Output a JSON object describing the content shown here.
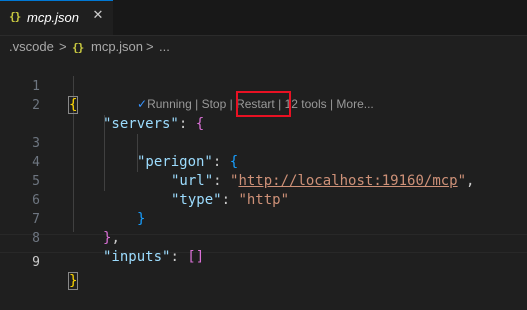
{
  "tab": {
    "icon": "{}",
    "label": "mcp.json",
    "close": "✕"
  },
  "breadcrumb": {
    "folder": ".vscode",
    "sep1": ">",
    "file_icon": "{}",
    "file": "mcp.json",
    "sep2": ">",
    "more": "..."
  },
  "line_numbers": [
    "1",
    "2",
    "3",
    "4",
    "5",
    "6",
    "7",
    "8",
    "9"
  ],
  "code": {
    "l1_open": "{",
    "l2_key": "\"servers\"",
    "l2_colon": ": ",
    "l2_brace": "{",
    "l3_key": "\"perigon\"",
    "l3_colon": ": ",
    "l3_brace": "{",
    "l4_key": "\"url\"",
    "l4_colon": ": ",
    "l4_q1": "\"",
    "l4_val": "http://localhost:19160/mcp",
    "l4_q2": "\"",
    "l4_comma": ",",
    "l5_key": "\"type\"",
    "l5_colon": ": ",
    "l5_val": "\"http\"",
    "l6_brace": "}",
    "l7_brace": "}",
    "l7_comma": ",",
    "l8_key": "\"inputs\"",
    "l8_colon": ": ",
    "l8_val": "[]",
    "l9_close": "}"
  },
  "codelens": {
    "running": "Running",
    "sep": "|",
    "stop": "Stop",
    "restart": "Restart",
    "tools": "12 tools",
    "more": "More..."
  },
  "colors": {
    "background": "#1f1f1f",
    "highlight_box": "#e81123",
    "key": "#9cdcfe",
    "string": "#ce9178"
  }
}
